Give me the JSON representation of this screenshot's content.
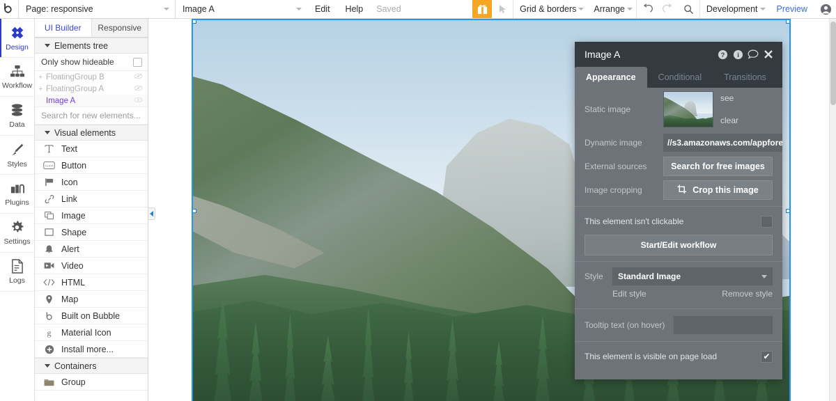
{
  "topbar": {
    "logo": "b",
    "page_select": "Page: responsive",
    "element_select": "Image A",
    "edit_label": "Edit",
    "help_label": "Help",
    "saved_label": "Saved",
    "gift_icon": "gift-icon",
    "pointer_icon": "pointer-icon",
    "grid_borders": "Grid & borders",
    "arrange": "Arrange",
    "undo_icon": "undo-icon",
    "redo_icon": "redo-icon",
    "search_icon": "search-icon",
    "version": "Development",
    "preview": "Preview",
    "avatar_icon": "user-avatar-icon",
    "accent_orange": "#F5A623",
    "link_blue": "#3b6ed8"
  },
  "rail": {
    "items": [
      {
        "label": "Design",
        "icon": "design-icon",
        "active": true
      },
      {
        "label": "Workflow",
        "icon": "workflow-icon",
        "active": false
      },
      {
        "label": "Data",
        "icon": "data-icon",
        "active": false
      },
      {
        "label": "Styles",
        "icon": "styles-icon",
        "active": false
      },
      {
        "label": "Plugins",
        "icon": "plugins-icon",
        "active": false
      },
      {
        "label": "Settings",
        "icon": "settings-icon",
        "active": false
      },
      {
        "label": "Logs",
        "icon": "logs-icon",
        "active": false
      }
    ],
    "active_color": "#2d3cc4"
  },
  "panel": {
    "tabs": [
      {
        "label": "UI Builder",
        "active": true
      },
      {
        "label": "Responsive",
        "active": false
      }
    ],
    "elements_tree_header": "Elements tree",
    "only_show_hideable": "Only show hideable",
    "only_show_hideable_checked": false,
    "tree": [
      {
        "name": "FloatingGroup B",
        "expandable": true,
        "selected": false,
        "hidden": true
      },
      {
        "name": "FloatingGroup A",
        "expandable": true,
        "selected": false,
        "hidden": true
      },
      {
        "name": "Image A",
        "expandable": false,
        "selected": true,
        "hidden": false
      }
    ],
    "search_placeholder": "Search for new elements...",
    "visual_elements_header": "Visual elements",
    "visual_elements": [
      {
        "label": "Text",
        "icon": "text-icon"
      },
      {
        "label": "Button",
        "icon": "button-icon"
      },
      {
        "label": "Icon",
        "icon": "flag-icon"
      },
      {
        "label": "Link",
        "icon": "link-icon"
      },
      {
        "label": "Image",
        "icon": "image-icon"
      },
      {
        "label": "Shape",
        "icon": "shape-icon"
      },
      {
        "label": "Alert",
        "icon": "bell-icon"
      },
      {
        "label": "Video",
        "icon": "video-icon"
      },
      {
        "label": "HTML",
        "icon": "code-icon"
      },
      {
        "label": "Map",
        "icon": "map-pin-icon"
      },
      {
        "label": "Built on Bubble",
        "icon": "bubble-logo-icon"
      },
      {
        "label": "Material Icon",
        "icon": "material-icon"
      },
      {
        "label": "Install more...",
        "icon": "plus-circle-icon"
      }
    ],
    "containers_header": "Containers",
    "containers": [
      {
        "label": "Group",
        "icon": "folder-icon"
      }
    ],
    "collapse_arrow_icon": "collapse-left-icon"
  },
  "property_editor": {
    "title": "Image A",
    "header_icons": [
      "help-circle-icon",
      "info-circle-icon",
      "comment-icon",
      "close-icon"
    ],
    "tabs": [
      {
        "label": "Appearance",
        "active": true
      },
      {
        "label": "Conditional",
        "active": false
      },
      {
        "label": "Transitions",
        "active": false
      }
    ],
    "static_image_label": "Static image",
    "see_link": "see",
    "clear_link": "clear",
    "dynamic_image_label": "Dynamic image",
    "dynamic_image_value": "//s3.amazonaws.com/appfores",
    "external_sources_label": "External sources",
    "search_free_images_button": "Search for free images",
    "image_cropping_label": "Image cropping",
    "crop_button": "Crop this image",
    "crop_icon": "crop-icon",
    "not_clickable_label": "This element isn't clickable",
    "not_clickable_checked": false,
    "start_edit_workflow_button": "Start/Edit workflow",
    "style_label": "Style",
    "style_value": "Standard Image",
    "edit_style_link": "Edit style",
    "remove_style_link": "Remove style",
    "tooltip_label": "Tooltip text (on hover)",
    "tooltip_value": "",
    "visible_on_page_load_label": "This element is visible on page load",
    "visible_on_page_load_checked": true,
    "panel_bg": "#6d7378",
    "header_bg": "#333a40"
  },
  "canvas": {
    "selection_color": "#2196f3",
    "image_alt": "Yosemite Valley with El Capitan and pine forest"
  }
}
